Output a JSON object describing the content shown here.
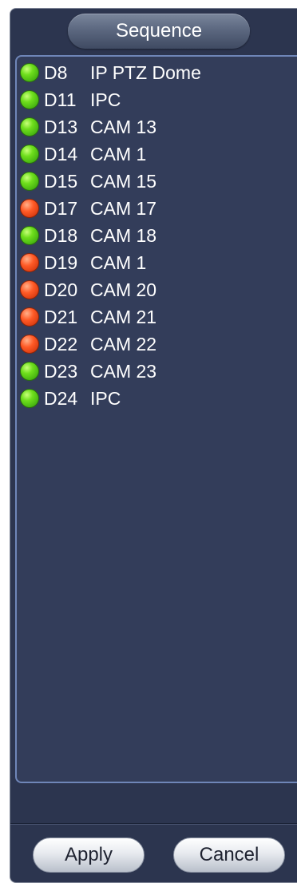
{
  "title": "Sequence",
  "channels": [
    {
      "id": "D8",
      "name": "IP PTZ Dome",
      "status": "online"
    },
    {
      "id": "D11",
      "name": "IPC",
      "status": "online"
    },
    {
      "id": "D13",
      "name": "CAM 13",
      "status": "online"
    },
    {
      "id": "D14",
      "name": "CAM 1",
      "status": "online"
    },
    {
      "id": "D15",
      "name": "CAM 15",
      "status": "online"
    },
    {
      "id": "D17",
      "name": "CAM 17",
      "status": "offline"
    },
    {
      "id": "D18",
      "name": "CAM 18",
      "status": "online"
    },
    {
      "id": "D19",
      "name": "CAM 1",
      "status": "offline"
    },
    {
      "id": "D20",
      "name": "CAM 20",
      "status": "offline"
    },
    {
      "id": "D21",
      "name": "CAM 21",
      "status": "offline"
    },
    {
      "id": "D22",
      "name": "CAM 22",
      "status": "offline"
    },
    {
      "id": "D23",
      "name": "CAM 23",
      "status": "online"
    },
    {
      "id": "D24",
      "name": "IPC",
      "status": "online"
    }
  ],
  "buttons": {
    "apply": "Apply",
    "cancel": "Cancel"
  },
  "colors": {
    "online": "#5fd11a",
    "offline": "#f2491b",
    "panel_bg": "#2c354f",
    "list_border": "#6f86b8"
  }
}
